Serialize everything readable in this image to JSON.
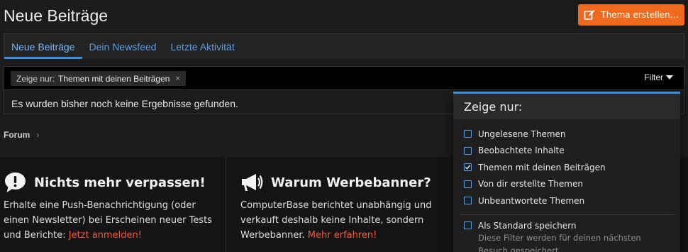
{
  "page": {
    "title": "Neue Beiträge",
    "new_thread_label": "Thema erstellen…"
  },
  "tabs": [
    {
      "label": "Neue Beiträge",
      "active": true
    },
    {
      "label": "Dein Newsfeed",
      "active": false
    },
    {
      "label": "Letzte Aktivität",
      "active": false
    }
  ],
  "filter_bar": {
    "chip_label": "Zeige nur:",
    "chip_value": "Themen mit deinen Beiträgen",
    "chip_close": "×",
    "toggle_label": "Filter"
  },
  "results": {
    "empty_message": "Es wurden bisher noch keine Ergebnisse gefunden."
  },
  "breadcrumb": {
    "item": "Forum",
    "separator": "›"
  },
  "promos": {
    "left": {
      "icon": "speech-bubble-exclamation-icon",
      "title": "Nichts mehr verpassen!",
      "text": "Erhalte eine Push-Benachrichtigung (oder einen Newsletter) bei Erscheinen neuer Tests und Berichte: ",
      "link": "Jetzt anmelden!"
    },
    "right": {
      "icon": "megaphone-icon",
      "title": "Warum Werbebanner?",
      "text": "ComputerBase berichtet unabhängig und verkauft deshalb keine Inhalte, sondern Werbebanner. ",
      "link": "Mehr erfahren!"
    }
  },
  "filter_menu": {
    "header": "Zeige nur:",
    "options": [
      {
        "label": "Ungelesene Themen",
        "checked": false
      },
      {
        "label": "Beobachtete Inhalte",
        "checked": false
      },
      {
        "label": "Themen mit deinen Beiträgen",
        "checked": true
      },
      {
        "label": "Von dir erstellte Themen",
        "checked": false
      },
      {
        "label": "Unbeantwortete Themen",
        "checked": false
      }
    ],
    "save_default": {
      "label": "Als Standard speichern",
      "checked": false
    },
    "hint": "Diese Filter werden für deinen nächsten Besuch gespeichert."
  },
  "colors": {
    "accent": "#3d8fe0",
    "brand_orange": "#f06a1d",
    "link_red": "#f05a3c",
    "background": "#1c1c1c"
  }
}
